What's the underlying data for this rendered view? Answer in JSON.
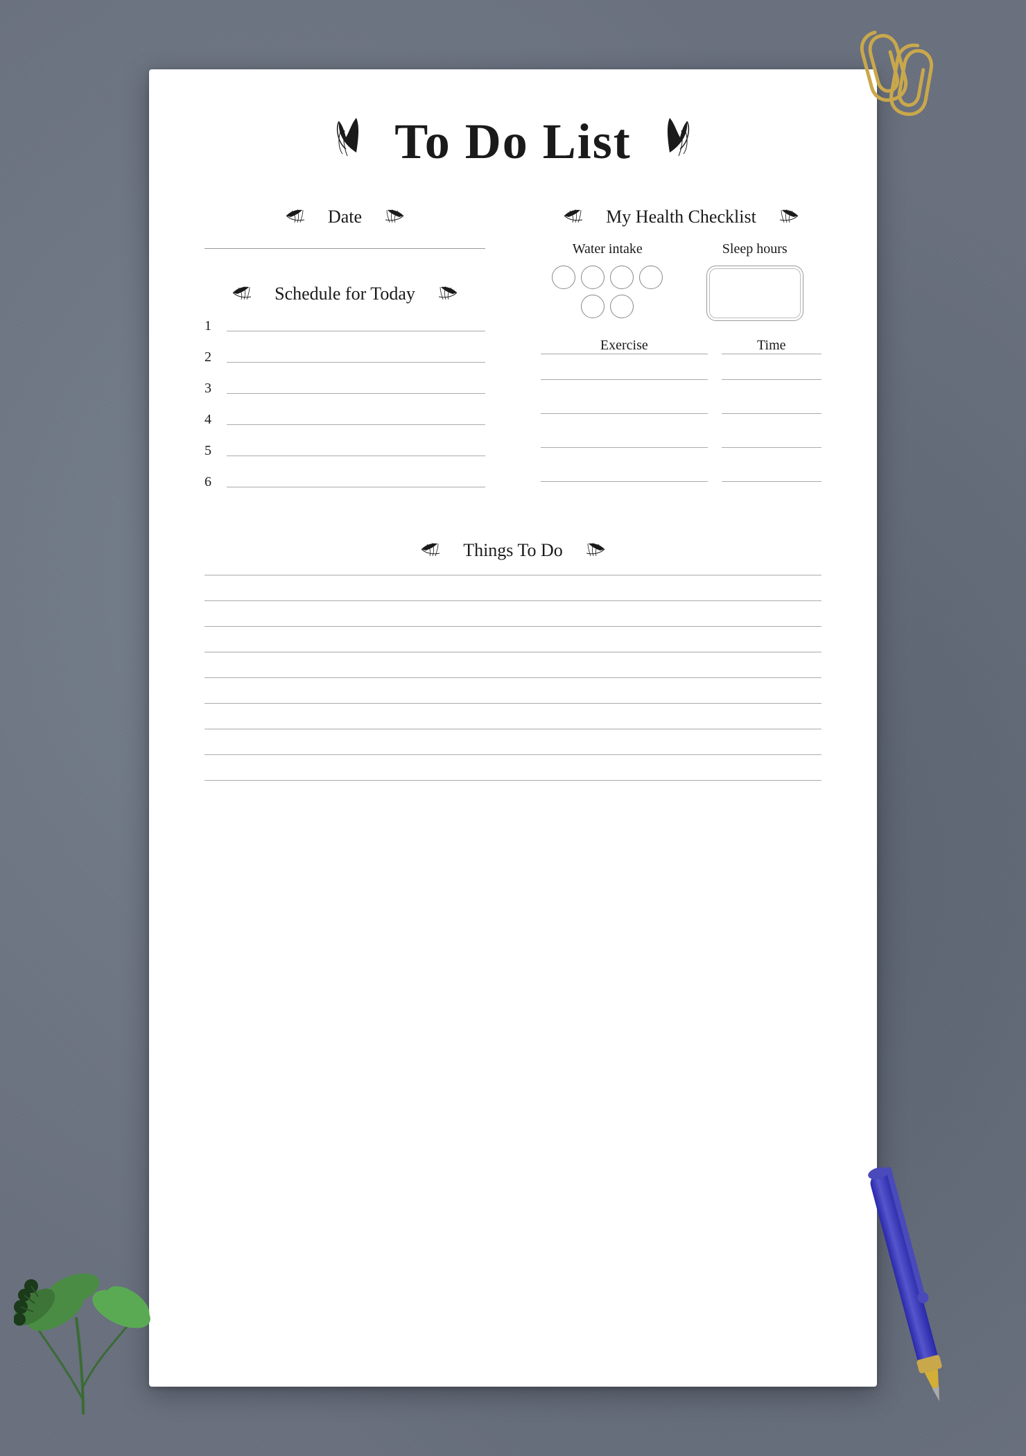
{
  "title": "To Do List",
  "sections": {
    "date": {
      "label": "Date"
    },
    "schedule": {
      "label": "Schedule for Today",
      "items": [
        {
          "number": "1"
        },
        {
          "number": "2"
        },
        {
          "number": "3"
        },
        {
          "number": "4"
        },
        {
          "number": "5"
        },
        {
          "number": "6"
        }
      ]
    },
    "health": {
      "label": "My Health Checklist",
      "waterIntake": "Water intake",
      "sleepHours": "Sleep hours",
      "exercise": "Exercise",
      "time": "Time",
      "exerciseRows": 4
    },
    "thingsToDo": {
      "label": "Things To Do",
      "lineCount": 9
    }
  },
  "decorations": {
    "leftLeaf": "❧",
    "rightLeaf": "❧"
  }
}
